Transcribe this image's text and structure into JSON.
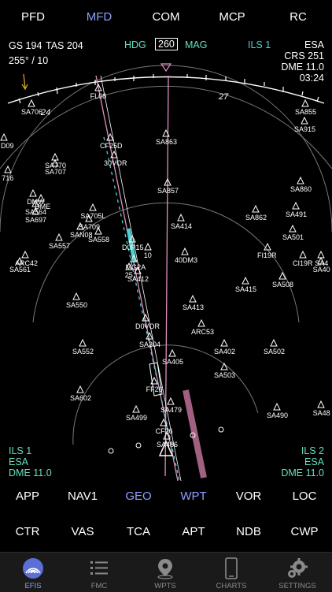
{
  "top_tabs": [
    "PFD",
    "MFD",
    "COM",
    "MCP",
    "RC"
  ],
  "top_tab_active": "MFD",
  "status": {
    "gs_label": "GS",
    "gs_value": "194",
    "tas_label": "TAS",
    "tas_value": "204",
    "wind": "255° /  10",
    "hdg_label": "HDG",
    "hdg_value": "260",
    "mag_label": "MAG",
    "approach": "ILS 1",
    "airport": "ESA",
    "crs": "CRS 251",
    "dme": "DME 11.0",
    "time": "03:24"
  },
  "compass": {
    "label_24": "24",
    "label_27": "27"
  },
  "waypoints": [
    "SA706",
    "SA855",
    "FL08",
    "SA915",
    "SA863",
    "CF25D",
    "SA770",
    "SA707",
    "30VOR",
    "SA857",
    "SA860",
    "SA564",
    "SA697",
    "SA491",
    "SA862",
    "SA414",
    "SA557",
    "SA558",
    "SA501",
    "SA561",
    "ARC42",
    "FI19R",
    "CI19R",
    "40DM3",
    "SA415",
    "SA412",
    "SA550",
    "SA413",
    "SA304",
    "ARC53",
    "SA552",
    "SA405",
    "SA402",
    "SA502",
    "SA503",
    "SA602",
    "FF26",
    "SA499",
    "SA479",
    "SA490",
    "CF26",
    "SA486",
    "SA40",
    "SA48",
    "D09",
    "716",
    "DME",
    "SA705L",
    "SA709",
    "DMW",
    "SA508",
    "SAN08",
    "SA4",
    "D0VOR",
    "MG2A",
    "25",
    "10",
    "D0P15"
  ],
  "left_info": {
    "approach": "ILS 1",
    "airport": "ESA",
    "dme": "DME 11.0"
  },
  "right_info": {
    "approach": "ILS 2",
    "airport": "ESA",
    "dme": "DME 11.0"
  },
  "mode_row1": [
    "APP",
    "NAV1",
    "GEO",
    "WPT",
    "VOR",
    "LOC"
  ],
  "mode_row1_active": [
    "GEO",
    "WPT"
  ],
  "mode_row2": [
    "CTR",
    "VAS",
    "TCA",
    "APT",
    "NDB",
    "CWP"
  ],
  "tabbar": {
    "items": [
      {
        "label": "EFIS",
        "icon": "efis-icon"
      },
      {
        "label": "FMC",
        "icon": "list-icon"
      },
      {
        "label": "WPTS",
        "icon": "map-pin-icon"
      },
      {
        "label": "CHARTS",
        "icon": "phone-icon"
      },
      {
        "label": "SETTINGS",
        "icon": "gear-icon"
      }
    ],
    "active": "EFIS"
  },
  "colors": {
    "accent": "#8fa0ff",
    "cyan": "#4fd0d0",
    "magenta_track": "#e090c0",
    "runway": "#a06080"
  }
}
